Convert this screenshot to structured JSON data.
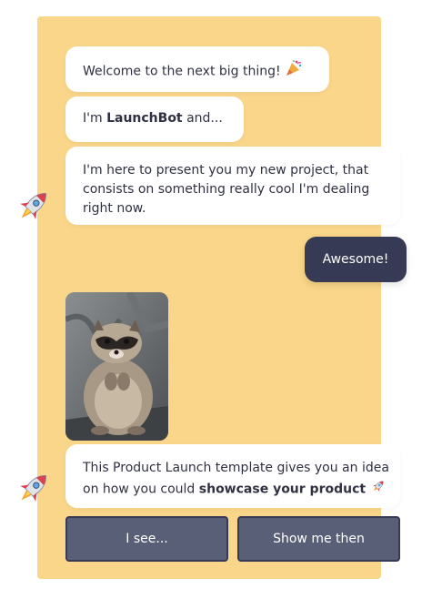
{
  "messages": {
    "welcome": "Welcome to the next big thing!",
    "intro_prefix": "I'm ",
    "bot_name": "LaunchBot",
    "intro_suffix": " and...",
    "project": "I'm here to present you my new project, that consists on something really cool I'm dealing right now.",
    "template_prefix": "This Product Launch template gives you an idea on how you could ",
    "template_bold": "showcase your product"
  },
  "user_reply": "Awesome!",
  "replies": [
    "I see...",
    "Show me then"
  ],
  "icons": {
    "celebrate": "party-popper-icon",
    "avatar": "rocket-icon"
  },
  "colors": {
    "panel": "#f9d689",
    "user_bubble": "#363a55",
    "reply_button": "#5a5f78"
  }
}
